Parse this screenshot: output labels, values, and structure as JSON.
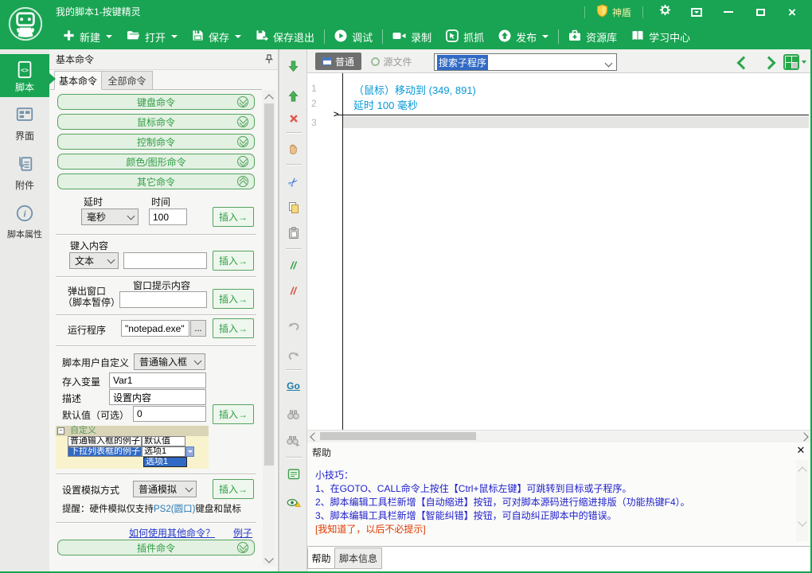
{
  "window": {
    "title": "我的脚本1-按键精灵",
    "shield_label": "神盾"
  },
  "toolbar": {
    "new": "新建",
    "open": "打开",
    "save": "保存",
    "save_exit": "保存退出",
    "debug": "调试",
    "record": "录制",
    "capture": "抓抓",
    "publish": "发布",
    "resources": "资源库",
    "learning": "学习中心"
  },
  "sidebar": {
    "script": "脚本",
    "ui": "界面",
    "attachment": "附件",
    "properties": "脚本属性"
  },
  "panel": {
    "title": "基本命令",
    "tab_basic": "基本命令",
    "tab_all": "全部命令",
    "acc_keyboard": "键盘命令",
    "acc_mouse": "鼠标命令",
    "acc_control": "控制命令",
    "acc_color": "颜色/图形命令",
    "acc_other": "其它命令",
    "acc_plugin": "插件命令",
    "insert_label": "插入→",
    "delay": {
      "label": "延时",
      "time_label": "时间",
      "unit": "毫秒",
      "time": "100"
    },
    "type_in": {
      "label": "键入内容",
      "mode": "文本"
    },
    "popup": {
      "label_line1": "弹出窗口",
      "label_line2": "（脚本暂停）",
      "hint_label": "窗口提示内容"
    },
    "run": {
      "label": "运行程序",
      "value": "\"notepad.exe\"",
      "browse": "..."
    },
    "custom": {
      "label": "脚本用户自定义",
      "mode": "普通输入框",
      "var_label": "存入变量",
      "var_value": "Var1",
      "desc_label": "描述",
      "desc_value": "设置内容",
      "default_label": "默认值（可选）",
      "default_value": "0",
      "preview_title": "自定义",
      "row1_name": "普通输入框的例子",
      "row1_value": "默认值",
      "row2_name": "下拉列表框的例子",
      "row2_value": "选项1",
      "dropdown_item": "选项1"
    },
    "sim": {
      "label": "设置模拟方式",
      "mode": "普通模拟",
      "note_pre": "提醒：硬件模拟仅支持",
      "note_mid": "PS2(圆口)",
      "note_post": "键盘和鼠标"
    },
    "links": {
      "how": "如何使用其他命令？",
      "example": "例子"
    }
  },
  "editor": {
    "btn_normal": "普通",
    "btn_source": "源文件",
    "search_value": "搜索子程序",
    "line1_no": "1",
    "line2_no": "2",
    "line3_no": "3",
    "line1": "（鼠标）移动到 (349, 891)",
    "line2": "延时 100 毫秒"
  },
  "help": {
    "title": "帮助",
    "tip_title": "小技巧：",
    "tip1": "1、在GOTO、CALL命令上按住【Ctrl+鼠标左键】可跳转到目标或子程序。",
    "tip2": "2、脚本编辑工具栏新增【自动缩进】按钮，可对脚本源码进行缩进排版（功能热键F4）。",
    "tip3": "3、脚本编辑工具栏新增【智能纠错】按钮，可自动纠正脚本中的错误。",
    "dismiss": "[我知道了，以后不必提示]",
    "tab_help": "帮助",
    "tab_info": "脚本信息"
  },
  "colors": {
    "brand_green": "#18a452",
    "selection_blue": "#316ac5",
    "code_blue": "#0898d8",
    "help_blue": "#2121cc",
    "alert_red": "#e03a00"
  }
}
